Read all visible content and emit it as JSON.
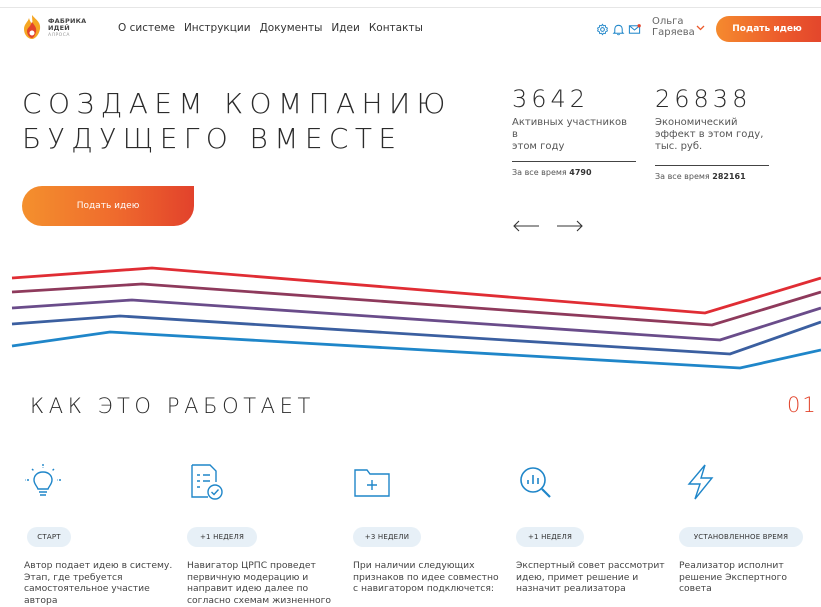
{
  "header": {
    "logo_line1": "ФАБРИКА",
    "logo_line2": "ИДЕЙ",
    "logo_sub": "АЛРОСА",
    "nav": [
      "О системе",
      "Инструкции",
      "Документы",
      "Идеи",
      "Контакты"
    ],
    "user_first": "Ольга",
    "user_last": "Гаряева",
    "cta": "Подать идею",
    "icons": [
      "gear-icon",
      "bell-icon",
      "mail-icon"
    ],
    "accent": "#ec5a2c"
  },
  "hero": {
    "title_line1": "СОЗДАЕМ КОМПАНИЮ",
    "title_line2": "БУДУЩЕГО ВМЕСТЕ",
    "cta": "Подать идею",
    "stats": [
      {
        "number": "3642",
        "label_lines": [
          "Активных участников в",
          "этом году"
        ],
        "total_prefix": "За все время",
        "total_value": "4790"
      },
      {
        "number": "26838",
        "label_lines": [
          "Экономический",
          "эффект в этом году,",
          "тыс. руб."
        ],
        "total_prefix": "За все время",
        "total_value": "282161"
      }
    ],
    "wave_colors": [
      "#e02d34",
      "#8e3a5c",
      "#6a4c8a",
      "#3b5fa0",
      "#1f86c9"
    ]
  },
  "how": {
    "title": "КАК ЭТО РАБОТАЕТ",
    "number": "01",
    "steps": [
      {
        "badge": "СТАРТ",
        "text_lines": [
          "Автор подает идею в систему.",
          "Этап, где требуется",
          "самостоятельное участие",
          "автора"
        ],
        "icon": "lightbulb-icon"
      },
      {
        "badge": "+1 НЕДЕЛЯ",
        "text_lines": [
          "Навигатор ЦРПС проведет",
          "первичную модерацию и",
          "направит идею далее по",
          "согласно схемам жизненного"
        ],
        "icon": "document-check-icon"
      },
      {
        "badge": "+3 НЕДЕЛИ",
        "text_lines": [
          "При наличии следующих",
          "признаков по идее совместно",
          "с навигатором подключется:"
        ],
        "icon": "folder-plus-icon"
      },
      {
        "badge": "+1 НЕДЕЛЯ",
        "text_lines": [
          "Экспертный совет рассмотрит",
          "идею, примет решение и",
          "назначит реализатора"
        ],
        "icon": "search-chart-icon"
      },
      {
        "badge": "УСТАНОВЛЕННОЕ ВРЕМЯ",
        "text_lines": [
          "Реализатор исполнит",
          "решение Экспертного совета"
        ],
        "icon": "lightning-icon"
      }
    ],
    "icon_color": "#1f86c9"
  }
}
